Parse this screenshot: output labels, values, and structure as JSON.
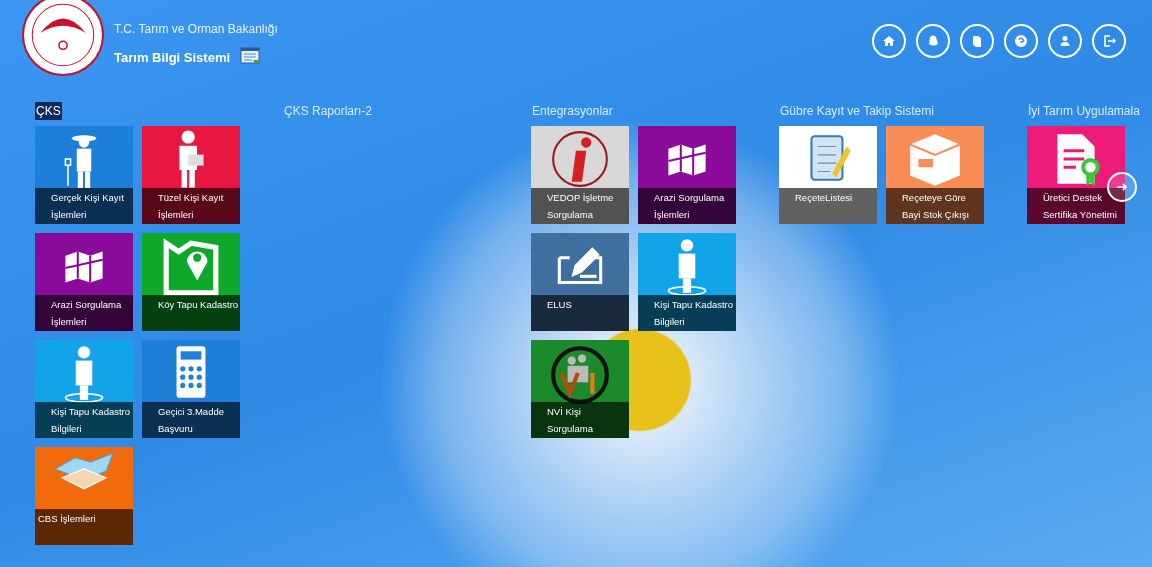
{
  "header": {
    "ministry": "T.C. Tarım ve Orman Bakanlığı",
    "system": "Tarım Bilgi Sistemi"
  },
  "groups": [
    {
      "title": "ÇKS",
      "selected": true,
      "tiles": [
        {
          "label": "Gerçek Kişi Kayıt İşlemleri",
          "kind": "farmer",
          "color": "#1e7fd8"
        },
        {
          "label": "Tüzel Kişi Kayıt İşlemleri",
          "kind": "businessman",
          "color": "#e8173f"
        },
        {
          "label": "Arazi Sorgulama İşlemleri",
          "kind": "map",
          "color": "#8a0a9a"
        },
        {
          "label": "Köy Tapu Kadastro",
          "kind": "pin",
          "color": "#0ea82a"
        },
        {
          "label": "Kişi Tapu Kadastro Bilgileri",
          "kind": "person",
          "color": "#12a4e8"
        },
        {
          "label": "Geçici 3.Madde Başvuru",
          "kind": "calculator",
          "color": "#1e7fd8"
        },
        {
          "label": "CBS İşlemleri",
          "kind": "terrain",
          "color": "#f26a0c"
        }
      ]
    },
    {
      "title": "ÇKS Raporları-2",
      "selected": false
    },
    {
      "title": "Entegrasyonlar",
      "selected": false,
      "tiles": [
        {
          "label": "VEDOP İşletme Sorgulama",
          "kind": "info",
          "color": "#d8d8d8"
        },
        {
          "label": "Arazi Sorgulama İşlemleri",
          "kind": "map",
          "color": "#8a0a9a"
        },
        {
          "label": "ELUS",
          "kind": "form",
          "color": "#3f6f9e"
        },
        {
          "label": "Kişi Tapu Kadastro Bilgileri",
          "kind": "person",
          "color": "#12a4e8"
        },
        {
          "label": "NVİ Kişi Sorgulama",
          "kind": "people",
          "color": "#1a8a2a"
        }
      ]
    },
    {
      "title": "Gübre Kayıt ve Takip Sistemi",
      "selected": false,
      "tiles": [
        {
          "label": "ReçeteListesi",
          "kind": "clipboard",
          "color": "#ffffff"
        },
        {
          "label": "Reçeteye Göre Bayi Stok Çıkışı",
          "kind": "box",
          "color": "#f98d55"
        }
      ]
    },
    {
      "title": "İyi Tarım Uygulamala",
      "selected": false,
      "tiles": [
        {
          "label": "Üretici Destek Sertifika Yönetimi",
          "kind": "certificate",
          "color": "#ec1a78"
        }
      ]
    }
  ]
}
